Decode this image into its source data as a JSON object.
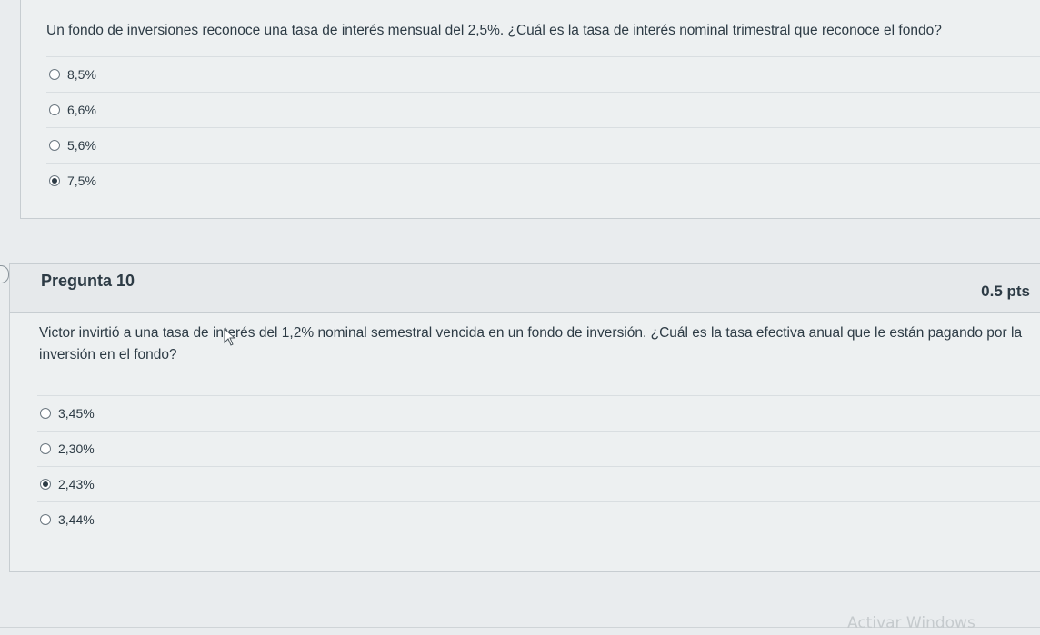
{
  "question9": {
    "text": "Un fondo de inversiones reconoce una tasa de interés mensual del 2,5%. ¿Cuál es la tasa de interés nominal trimestral que reconoce el fondo?",
    "answers": [
      {
        "label": "8,5%",
        "selected": false
      },
      {
        "label": "6,6%",
        "selected": false
      },
      {
        "label": "5,6%",
        "selected": false
      },
      {
        "label": "7,5%",
        "selected": true
      }
    ]
  },
  "question10": {
    "title": "Pregunta 10",
    "points": "0.5 pts",
    "text": "Victor invirtió a una tasa de interés del 1,2% nominal semestral vencida en un fondo de inversión. ¿Cuál es la tasa efectiva anual que le están pagando por la inversión en el fondo?",
    "answers": [
      {
        "label": "3,45%",
        "selected": false
      },
      {
        "label": "2,30%",
        "selected": false
      },
      {
        "label": "2,43%",
        "selected": true
      },
      {
        "label": "3,44%",
        "selected": false
      }
    ]
  },
  "watermark": "Activar Windows",
  "icons": {
    "flag": "flag-question-icon",
    "cursor": "mouse-cursor-icon"
  }
}
